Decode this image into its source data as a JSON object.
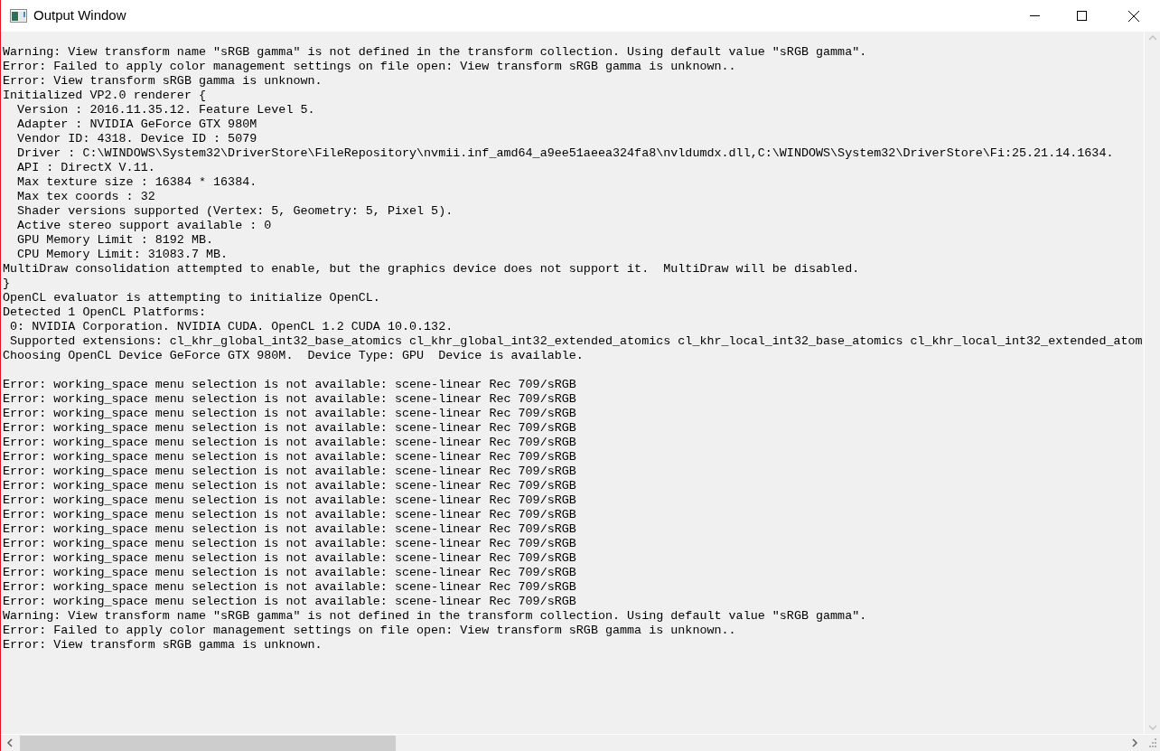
{
  "window": {
    "title": "Output Window"
  },
  "log_blocks": [
    [
      "Warning: View transform name \"sRGB gamma\" is not defined in the transform collection. Using default value \"sRGB gamma\".",
      "Error: Failed to apply color management settings on file open: View transform sRGB gamma is unknown..",
      "Error: View transform sRGB gamma is unknown.",
      "Initialized VP2.0 renderer {",
      "  Version : 2016.11.35.12. Feature Level 5.",
      "  Adapter : NVIDIA GeForce GTX 980M",
      "  Vendor ID: 4318. Device ID : 5079",
      "  Driver : C:\\WINDOWS\\System32\\DriverStore\\FileRepository\\nvmii.inf_amd64_a9ee51aeea324fa8\\nvldumdx.dll,C:\\WINDOWS\\System32\\DriverStore\\Fi:25.21.14.1634.",
      "  API : DirectX V.11.",
      "  Max texture size : 16384 * 16384.",
      "  Max tex coords : 32",
      "  Shader versions supported (Vertex: 5, Geometry: 5, Pixel 5).",
      "  Active stereo support available : 0",
      "  GPU Memory Limit : 8192 MB.",
      "  CPU Memory Limit: 31083.7 MB.",
      "MultiDraw consolidation attempted to enable, but the graphics device does not support it.  MultiDraw will be disabled.",
      "}",
      "OpenCL evaluator is attempting to initialize OpenCL.",
      "Detected 1 OpenCL Platforms:",
      " 0: NVIDIA Corporation. NVIDIA CUDA. OpenCL 1.2 CUDA 10.0.132.",
      " Supported extensions: cl_khr_global_int32_base_atomics cl_khr_global_int32_extended_atomics cl_khr_local_int32_base_atomics cl_khr_local_int32_extended_atom",
      "Choosing OpenCL Device GeForce GTX 980M.  Device Type: GPU  Device is available."
    ],
    [
      "Error: working_space menu selection is not available: scene-linear Rec 709/sRGB",
      "Error: working_space menu selection is not available: scene-linear Rec 709/sRGB",
      "Error: working_space menu selection is not available: scene-linear Rec 709/sRGB",
      "Error: working_space menu selection is not available: scene-linear Rec 709/sRGB",
      "Error: working_space menu selection is not available: scene-linear Rec 709/sRGB",
      "Error: working_space menu selection is not available: scene-linear Rec 709/sRGB",
      "Error: working_space menu selection is not available: scene-linear Rec 709/sRGB",
      "Error: working_space menu selection is not available: scene-linear Rec 709/sRGB",
      "Error: working_space menu selection is not available: scene-linear Rec 709/sRGB",
      "Error: working_space menu selection is not available: scene-linear Rec 709/sRGB",
      "Error: working_space menu selection is not available: scene-linear Rec 709/sRGB",
      "Error: working_space menu selection is not available: scene-linear Rec 709/sRGB",
      "Error: working_space menu selection is not available: scene-linear Rec 709/sRGB",
      "Error: working_space menu selection is not available: scene-linear Rec 709/sRGB",
      "Error: working_space menu selection is not available: scene-linear Rec 709/sRGB",
      "Error: working_space menu selection is not available: scene-linear Rec 709/sRGB",
      "Warning: View transform name \"sRGB gamma\" is not defined in the transform collection. Using default value \"sRGB gamma\".",
      "Error: Failed to apply color management settings on file open: View transform sRGB gamma is unknown..",
      "Error: View transform sRGB gamma is unknown."
    ]
  ]
}
